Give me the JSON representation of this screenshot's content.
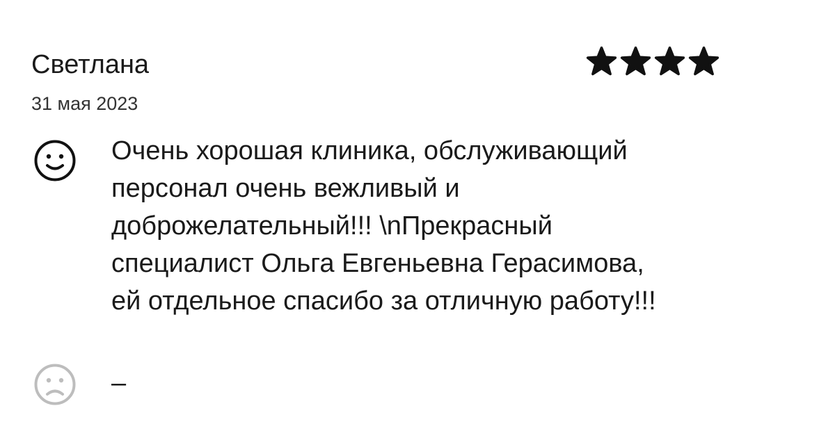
{
  "review": {
    "author": "Светлана",
    "date": "31 мая 2023",
    "rating": 4,
    "rating_max": 4,
    "positive_icon": "smile-icon",
    "negative_icon": "frown-icon",
    "positive_lines": [
      "Очень хорошая клиника, обслуживающий",
      "персонал очень вежливый и",
      "доброжелательный!!! \\nПрекрасный",
      "специалист Ольга Евгеньевна Герасимова,",
      "ей отдельное спасибо за отличную работу!!!"
    ],
    "negative_text": "–"
  },
  "colors": {
    "text": "#1a1a1a",
    "star": "#111111",
    "positive_icon": "#111111",
    "negative_icon": "#bdbdbd"
  }
}
